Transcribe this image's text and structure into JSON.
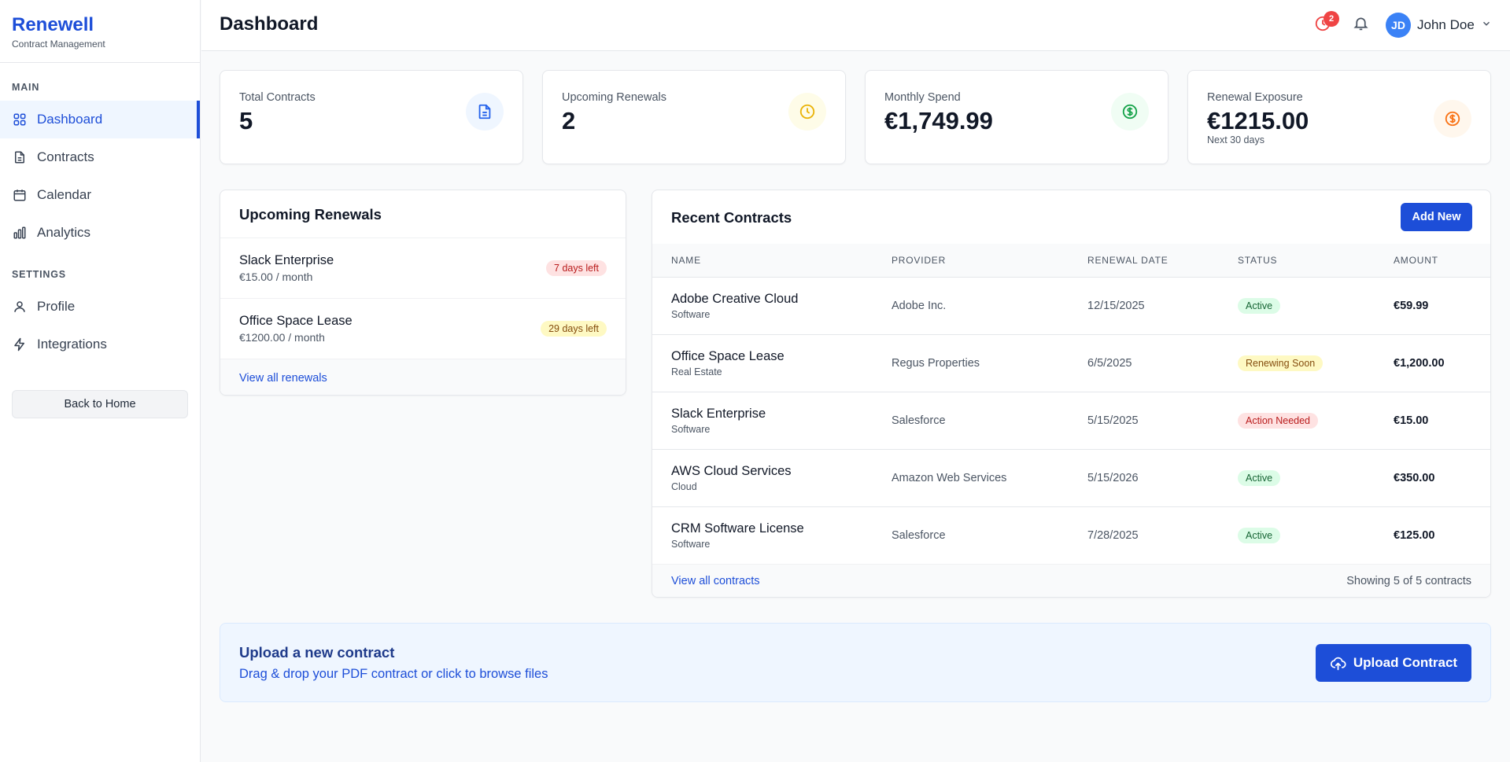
{
  "brand": {
    "name": "Renewell",
    "subtitle": "Contract Management"
  },
  "sidebar": {
    "main_label": "MAIN",
    "main_items": [
      {
        "label": "Dashboard",
        "icon": "grid-icon",
        "active": true
      },
      {
        "label": "Contracts",
        "icon": "document-icon"
      },
      {
        "label": "Calendar",
        "icon": "calendar-icon"
      },
      {
        "label": "Analytics",
        "icon": "bar-chart-icon"
      }
    ],
    "settings_label": "SETTINGS",
    "settings_items": [
      {
        "label": "Profile",
        "icon": "user-icon"
      },
      {
        "label": "Integrations",
        "icon": "lightning-icon"
      }
    ],
    "back_label": "Back to Home"
  },
  "header": {
    "title": "Dashboard",
    "alerts_count": "2",
    "user": {
      "initials": "JD",
      "name": "John Doe"
    }
  },
  "stats": [
    {
      "label": "Total Contracts",
      "value": "5",
      "icon": "document-icon",
      "color": "#2563eb"
    },
    {
      "label": "Upcoming Renewals",
      "value": "2",
      "icon": "clock-icon",
      "color": "#eab308"
    },
    {
      "label": "Monthly Spend",
      "value": "€1,749.99",
      "icon": "dollar-icon",
      "color": "#16a34a"
    },
    {
      "label": "Renewal Exposure",
      "value": "€1215.00",
      "note": "Next 30 days",
      "icon": "dollar-icon",
      "color": "#f97316"
    }
  ],
  "upcoming": {
    "title": "Upcoming Renewals",
    "items": [
      {
        "name": "Slack Enterprise",
        "price": "€15.00 / month",
        "days": "7 days left",
        "tone": "red"
      },
      {
        "name": "Office Space Lease",
        "price": "€1200.00 / month",
        "days": "29 days left",
        "tone": "yellow"
      }
    ],
    "link": "View all renewals"
  },
  "recent": {
    "title": "Recent Contracts",
    "add_label": "Add New",
    "columns": [
      "NAME",
      "PROVIDER",
      "RENEWAL DATE",
      "STATUS",
      "AMOUNT"
    ],
    "rows": [
      {
        "name": "Adobe Creative Cloud",
        "category": "Software",
        "provider": "Adobe Inc.",
        "date": "12/15/2025",
        "status": "Active",
        "tone": "green",
        "amount": "€59.99"
      },
      {
        "name": "Office Space Lease",
        "category": "Real Estate",
        "provider": "Regus Properties",
        "date": "6/5/2025",
        "status": "Renewing Soon",
        "tone": "yellow",
        "amount": "€1,200.00"
      },
      {
        "name": "Slack Enterprise",
        "category": "Software",
        "provider": "Salesforce",
        "date": "5/15/2025",
        "status": "Action Needed",
        "tone": "red",
        "amount": "€15.00"
      },
      {
        "name": "AWS Cloud Services",
        "category": "Cloud",
        "provider": "Amazon Web Services",
        "date": "5/15/2026",
        "status": "Active",
        "tone": "green",
        "amount": "€350.00"
      },
      {
        "name": "CRM Software License",
        "category": "Software",
        "provider": "Salesforce",
        "date": "7/28/2025",
        "status": "Active",
        "tone": "green",
        "amount": "€125.00"
      }
    ],
    "link": "View all contracts",
    "summary": "Showing 5 of 5 contracts"
  },
  "upload": {
    "title": "Upload a new contract",
    "subtitle": "Drag & drop your PDF contract or click to browse files",
    "button": "Upload Contract"
  },
  "colors": {
    "primary": "#1d4ed8",
    "pill_red_bg": "#fee2e2",
    "pill_red_fg": "#b91c1c",
    "pill_yellow_bg": "#fef9c3",
    "pill_yellow_fg": "#854d0e",
    "pill_green_bg": "#dcfce7",
    "pill_green_fg": "#166534"
  }
}
